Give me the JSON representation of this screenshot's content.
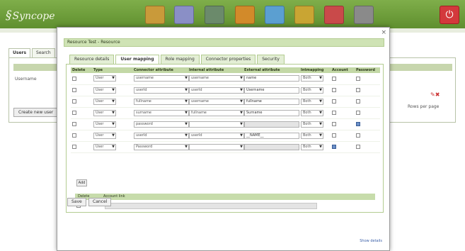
{
  "app": {
    "logo": "Syncope",
    "toolbar_icons": [
      {
        "name": "configuration-icon",
        "color": "#c99a3a"
      },
      {
        "name": "users-icon",
        "color": "#8a8fc6"
      },
      {
        "name": "roles-icon",
        "color": "#6b8a6b"
      },
      {
        "name": "resources-icon",
        "color": "#d28a2a"
      },
      {
        "name": "connectors-icon",
        "color": "#5b9fd1"
      },
      {
        "name": "schema-icon",
        "color": "#c9a533"
      },
      {
        "name": "reports-icon",
        "color": "#c94a4a"
      },
      {
        "name": "tasks-icon",
        "color": "#8a8a8a"
      }
    ],
    "power_icon": "power-icon"
  },
  "background": {
    "tabs": [
      "Users",
      "Search"
    ],
    "row_label": "Username",
    "button": "Create new user",
    "pager": "Rows per page"
  },
  "modal": {
    "title": "Resource Test - Resource",
    "tabs": [
      "Resource details",
      "User mapping",
      "Role mapping",
      "Connector properties",
      "Security"
    ],
    "active_tab": 1,
    "columns": [
      "Delete",
      "Type",
      "Connector attribute",
      "Internal attribute",
      "External attribute",
      "Intmapping",
      "Account",
      "Password"
    ],
    "rows": [
      {
        "type": "User",
        "connector": "username",
        "internal": "username",
        "external": "name",
        "intmapping": "Both",
        "account": false,
        "password": false
      },
      {
        "type": "User",
        "connector": "userId",
        "internal": "userId",
        "external": "Username",
        "intmapping": "Both",
        "account": false,
        "password": false
      },
      {
        "type": "User",
        "connector": "fullname",
        "internal": "username",
        "external": "fullname",
        "intmapping": "Both",
        "account": false,
        "password": false
      },
      {
        "type": "User",
        "connector": "surname",
        "internal": "fullname",
        "external": "Surname",
        "intmapping": "Both",
        "account": false,
        "password": false
      },
      {
        "type": "User",
        "connector": "password",
        "internal": "",
        "external": "",
        "intmapping": "Both",
        "account": false,
        "password": true
      },
      {
        "type": "User",
        "connector": "userId",
        "internal": "userId",
        "external": "__NAME__",
        "intmapping": "Both",
        "account": false,
        "password": false
      },
      {
        "type": "User",
        "connector": "Password",
        "internal": "",
        "external": "",
        "intmapping": "Both",
        "account": true,
        "password": false
      }
    ],
    "add_label": "Add",
    "bottom_headers": [
      "Delete",
      "Account link"
    ],
    "save_label": "Save",
    "cancel_label": "Cancel",
    "footer_link": "Show details",
    "close_symbol": "×"
  }
}
